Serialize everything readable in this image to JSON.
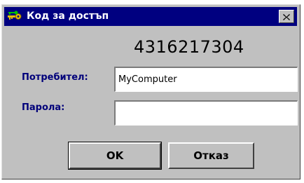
{
  "window": {
    "title": "Код за достъп",
    "icon": "keys-icon",
    "close_icon": "close-icon"
  },
  "code": "4316217304",
  "form": {
    "user_label": "Потребител:",
    "user_value": "MyComputer",
    "password_label": "Парола:",
    "password_value": ""
  },
  "buttons": {
    "ok_label": "OK",
    "cancel_label": "Отказ"
  },
  "colors": {
    "titlebar": "#000080",
    "dialog_bg": "#c0c0c0",
    "label_text": "#00007a"
  }
}
